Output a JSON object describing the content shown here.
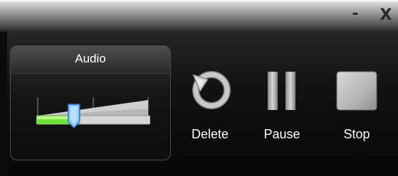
{
  "window": {
    "minimize_label": "-",
    "close_label": "X"
  },
  "audio": {
    "title": "Audio",
    "volume_level": 0.33
  },
  "controls": {
    "delete_label": "Delete",
    "pause_label": "Pause",
    "stop_label": "Stop"
  }
}
